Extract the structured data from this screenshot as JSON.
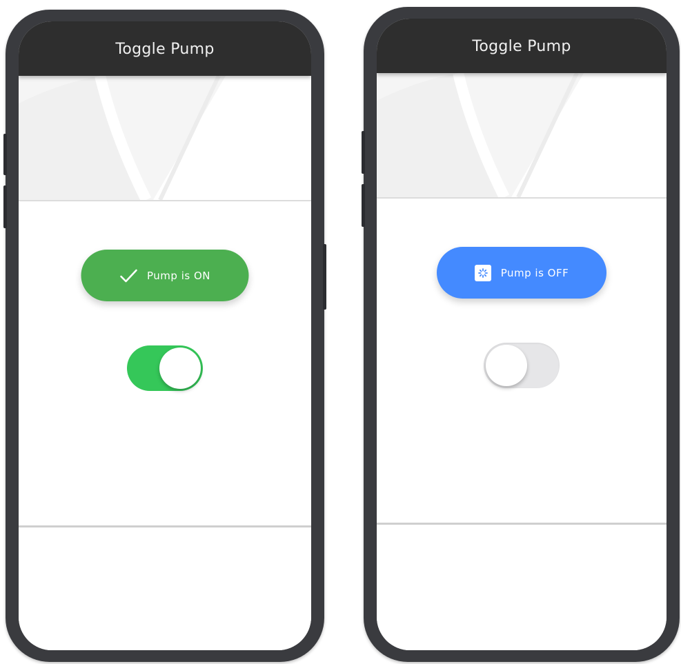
{
  "phones": [
    {
      "appbar_title": "Toggle Pump",
      "status_button_label": "Pump is ON",
      "status_icon": "check-icon",
      "switch_state": "on",
      "accent_color": "#4caf50"
    },
    {
      "appbar_title": "Toggle Pump",
      "status_button_label": "Pump is OFF",
      "status_icon": "settings-icon",
      "switch_state": "off",
      "accent_color": "#448aff"
    }
  ]
}
